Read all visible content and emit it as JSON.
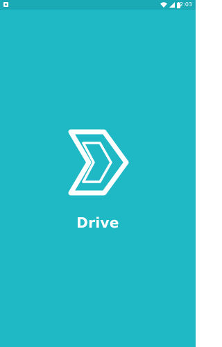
{
  "status_bar": {
    "time": "2:03",
    "icons": [
      "notification-icon",
      "wifi-icon",
      "signal-icon",
      "battery-icon"
    ]
  },
  "splash": {
    "app_name": "Drive",
    "logo_icon": "drive-logo-icon"
  },
  "colors": {
    "background": "#1fb9c6",
    "status_bar": "#1aaab6",
    "foreground": "#ffffff"
  }
}
